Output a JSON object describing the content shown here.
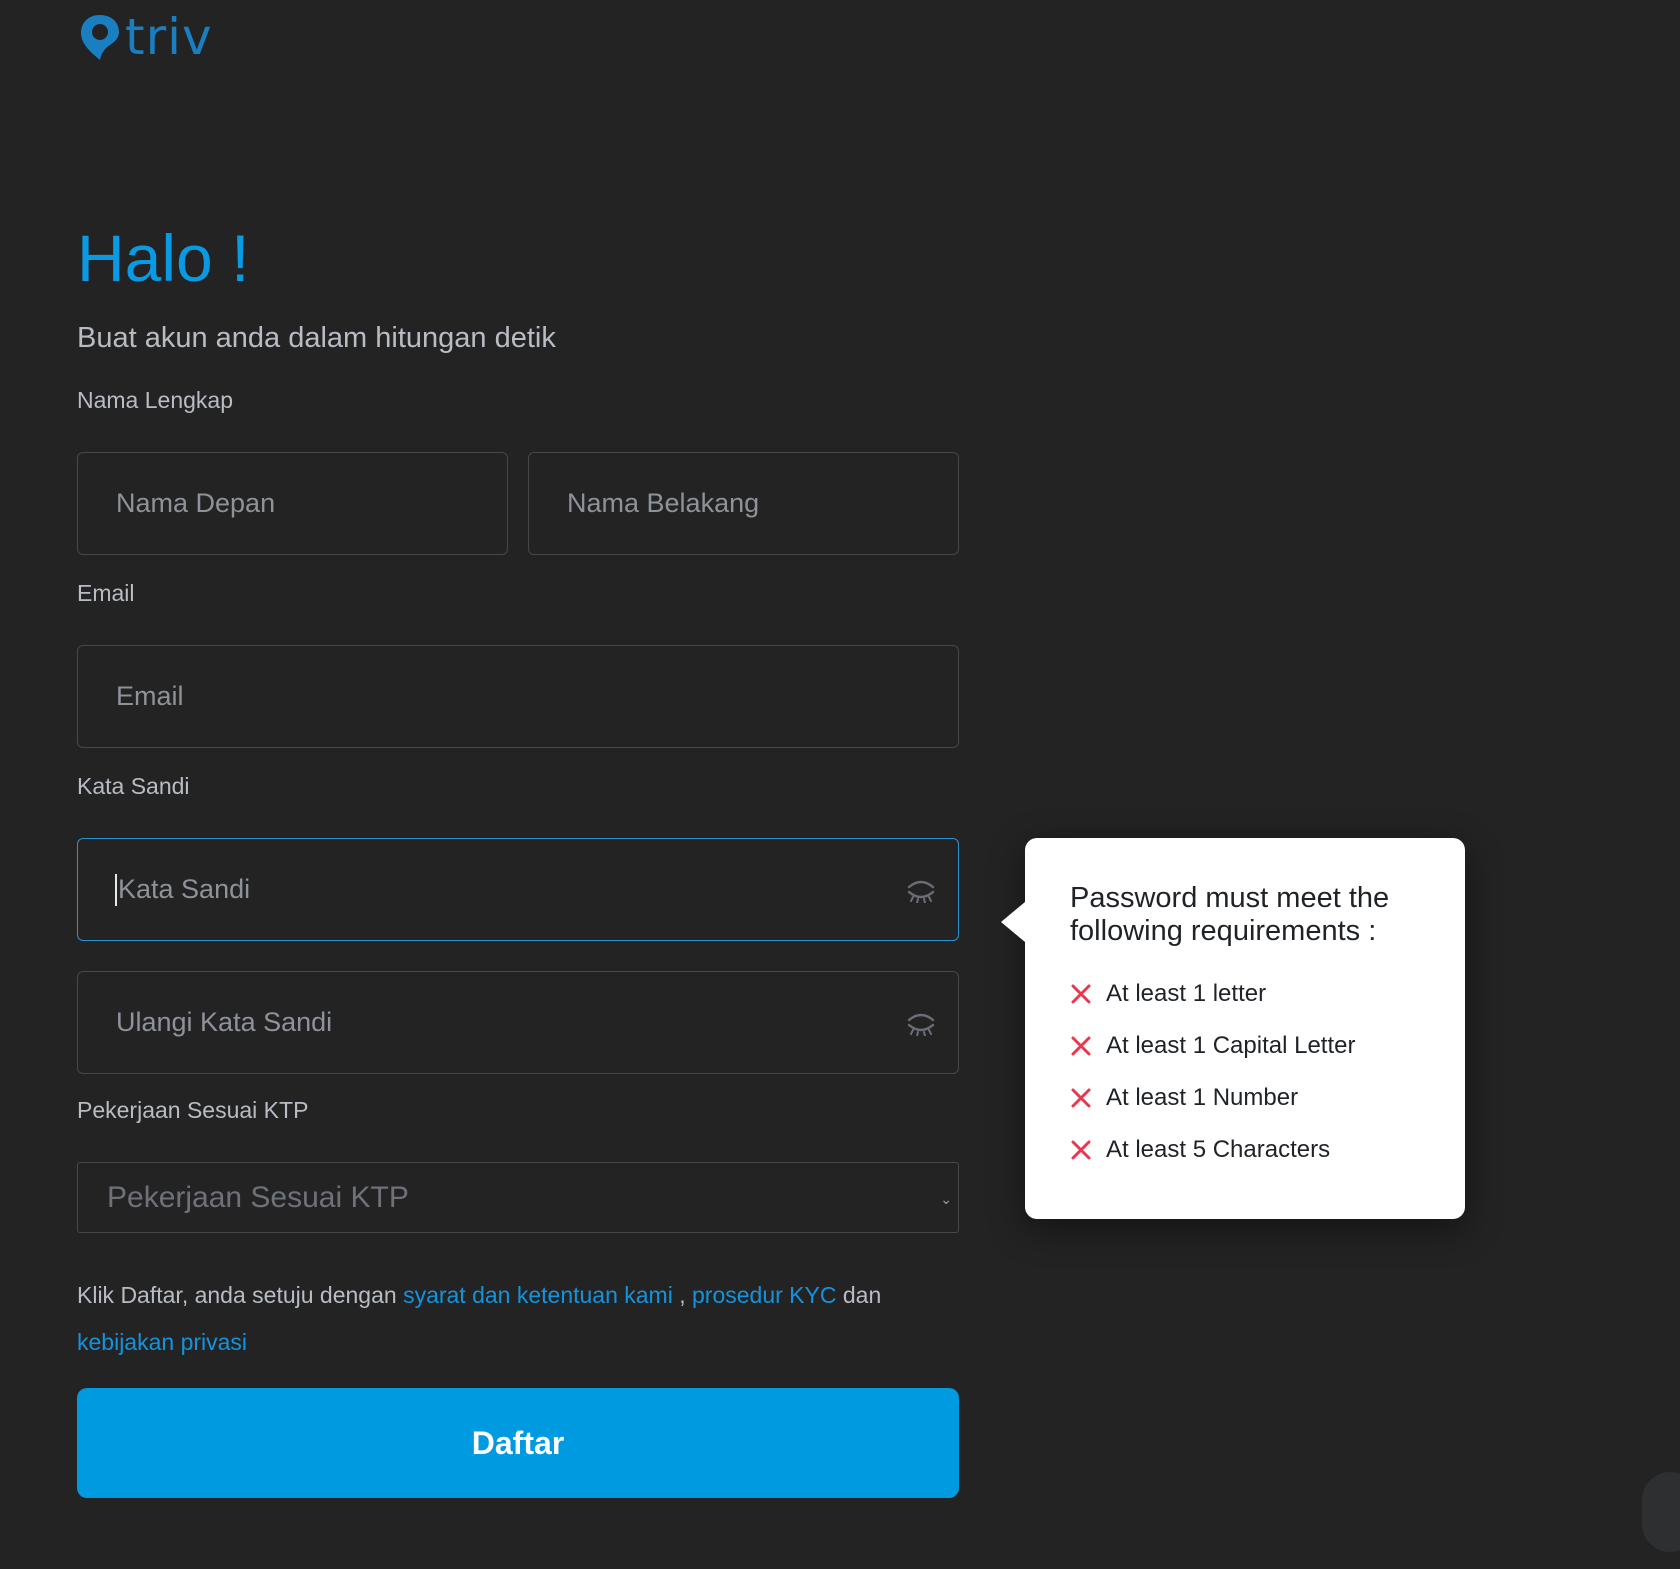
{
  "brand": {
    "name": "triv",
    "color": "#1a7fc1",
    "logo_icon": "location-pin-icon"
  },
  "header": {
    "greeting": "Halo !",
    "subtitle": "Buat akun anda dalam hitungan detik"
  },
  "form": {
    "full_name": {
      "label": "Nama Lengkap",
      "first_placeholder": "Nama Depan",
      "last_placeholder": "Nama Belakang",
      "first_value": "",
      "last_value": ""
    },
    "email": {
      "label": "Email",
      "placeholder": "Email",
      "value": ""
    },
    "password": {
      "label": "Kata Sandi",
      "placeholder": "Kata Sandi",
      "confirm_placeholder": "Ulangi Kata Sandi",
      "toggle_icon": "eye-closed-icon",
      "value": ""
    },
    "occupation": {
      "label": "Pekerjaan Sesuai KTP",
      "selected": "Pekerjaan Sesuai KTP",
      "icon": "chevron-down-icon"
    },
    "terms": {
      "prefix": "Klik Daftar, anda setuju dengan ",
      "link_terms": "syarat dan ketentuan kami",
      "separator": " , ",
      "link_kyc": "prosedur KYC",
      "conjunction": "  dan ",
      "link_privacy": "kebijakan privasi"
    },
    "submit_label": "Daftar"
  },
  "password_requirements": {
    "title": "Password must meet the following requirements :",
    "items": [
      {
        "text": "At least 1 letter",
        "met": false
      },
      {
        "text": "At least 1 Capital Letter",
        "met": false
      },
      {
        "text": "At least 1 Number",
        "met": false
      },
      {
        "text": "At least 5 Characters",
        "met": false
      }
    ],
    "fail_icon": "x-mark-icon"
  },
  "colors": {
    "background": "#232324",
    "accent": "#009ae1",
    "heading": "#0a9ae4",
    "link": "#1493dd",
    "fail": "#e8384f"
  }
}
